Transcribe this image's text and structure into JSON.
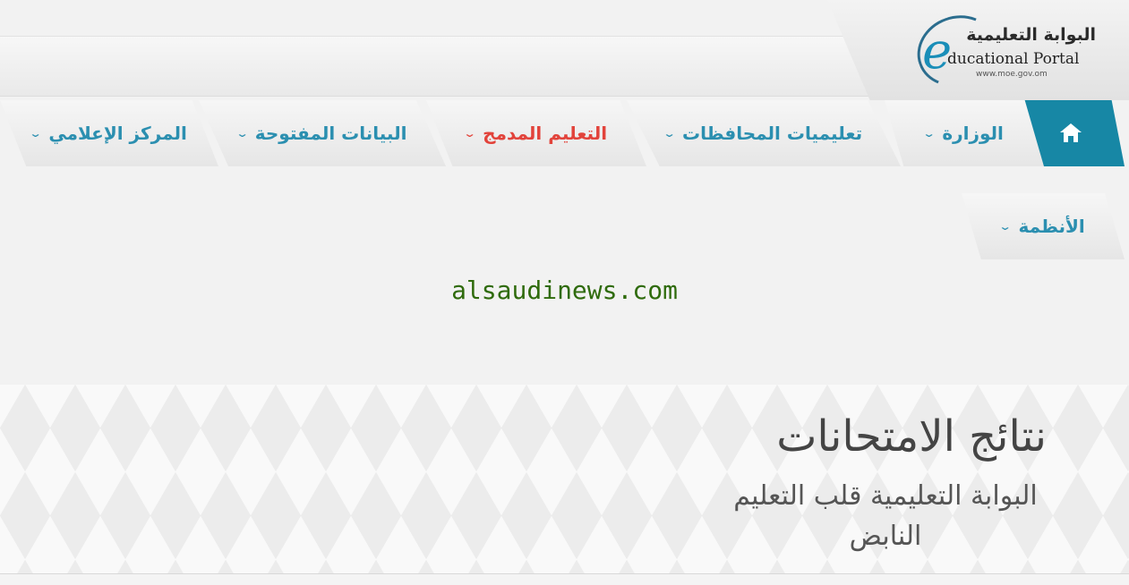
{
  "logo": {
    "arabic": "البوابة التعليمية",
    "english": "ducational Portal",
    "e_letter": "e",
    "url": "www.moe.gov.om"
  },
  "nav": {
    "home_icon": "home-icon",
    "items": [
      {
        "label": "الوزارة",
        "active": false
      },
      {
        "label": "تعليميات المحافظات",
        "active": false
      },
      {
        "label": "التعليم المدمج",
        "active": true
      },
      {
        "label": "البيانات المفتوحة",
        "active": false
      },
      {
        "label": "المركز الإعلامي",
        "active": false
      },
      {
        "label": "الأنظمة",
        "active": false
      }
    ],
    "chevron": "⌄"
  },
  "watermark": "alsaudinews.com",
  "hero": {
    "title": "نتائج الامتحانات",
    "subtitle": "البوابة التعليمية قلب التعليم النابض"
  },
  "colors": {
    "accent": "#1787a5",
    "link": "#2b8fb0",
    "active": "#e2433b",
    "watermark": "#2f6b0c"
  }
}
